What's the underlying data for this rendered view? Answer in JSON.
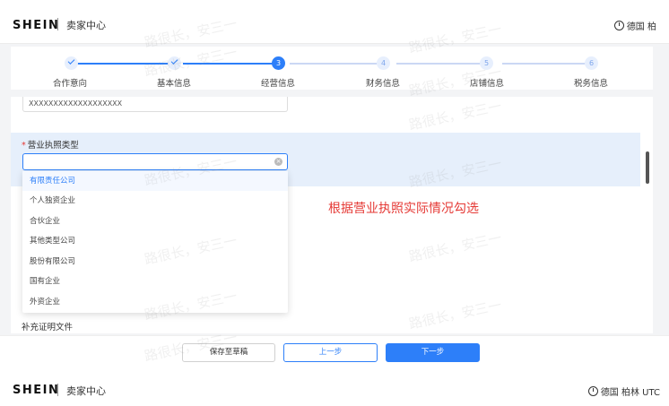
{
  "header": {
    "brand": "SHEIN",
    "title": "卖家中心",
    "region": "德国 柏"
  },
  "steps": [
    {
      "number": "✓",
      "label": "合作意向",
      "status": "done"
    },
    {
      "number": "✓",
      "label": "基本信息",
      "status": "done"
    },
    {
      "number": "3",
      "label": "经营信息",
      "status": "active"
    },
    {
      "number": "4",
      "label": "财务信息",
      "status": "todo"
    },
    {
      "number": "5",
      "label": "店铺信息",
      "status": "todo"
    },
    {
      "number": "6",
      "label": "税务信息",
      "status": "todo"
    }
  ],
  "form": {
    "previous_value": "XXXXXXXXXXXXXXXXXXX",
    "license_type_label": "营业执照类型",
    "required_mark": "*",
    "license_type_value": "",
    "license_type_options": [
      "有限责任公司",
      "个人独资企业",
      "合伙企业",
      "其他类型公司",
      "股份有限公司",
      "国有企业",
      "外资企业"
    ],
    "highlighted_option": "有限责任公司",
    "supplementary_label": "补充证明文件"
  },
  "annotation": "根据营业执照实际情况勾选",
  "footer": {
    "save_draft": "保存至草稿",
    "prev": "上一步",
    "next": "下一步"
  },
  "bottom_header": {
    "brand": "SHEIN",
    "title": "卖家中心",
    "region": "德国 柏林 UTC"
  },
  "watermark": "路很长，安三一",
  "colors": {
    "primary": "#2d7ff9",
    "annotation": "#e53935",
    "highlight_row": "#e6effb"
  }
}
